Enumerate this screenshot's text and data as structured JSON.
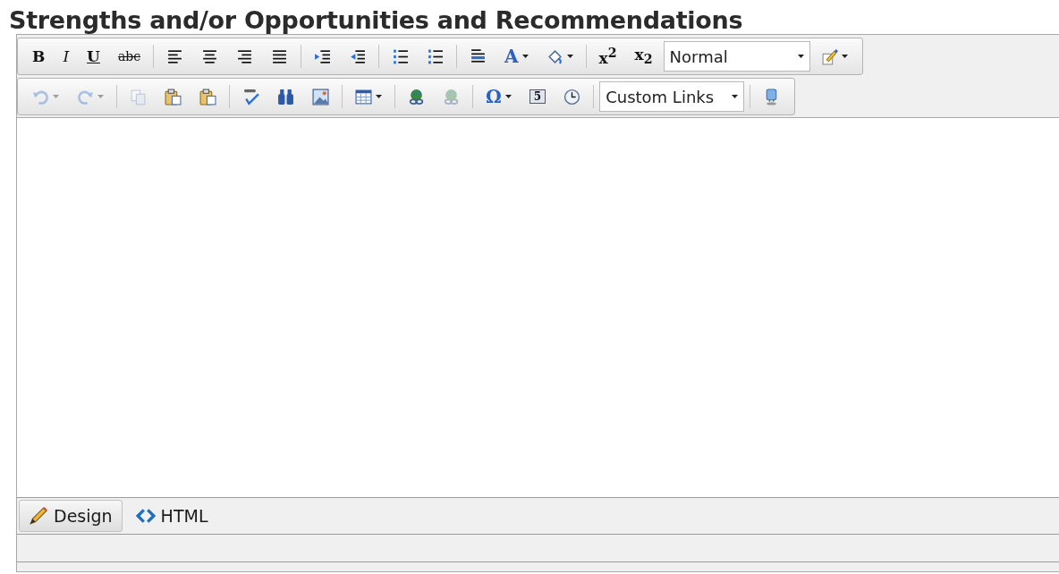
{
  "title": "Strengths and/or Opportunities and Recommendations",
  "toolbars": [
    {
      "items": [
        {
          "kind": "glyph",
          "text": "B",
          "disabled": false,
          "dropdown": false
        },
        {
          "kind": "glyph",
          "text": "I",
          "disabled": false,
          "dropdown": false
        },
        {
          "kind": "glyph",
          "text": "U",
          "disabled": false,
          "dropdown": false
        },
        {
          "kind": "glyph",
          "text": "abc",
          "disabled": false,
          "dropdown": false
        },
        {
          "kind": "separator"
        },
        {
          "kind": "icon",
          "disabled": false,
          "dropdown": false
        },
        {
          "kind": "icon",
          "disabled": false,
          "dropdown": false
        },
        {
          "kind": "icon",
          "disabled": false,
          "dropdown": false
        },
        {
          "kind": "icon",
          "disabled": false,
          "dropdown": false
        },
        {
          "kind": "separator"
        },
        {
          "kind": "icon",
          "disabled": false,
          "dropdown": false
        },
        {
          "kind": "icon",
          "disabled": false,
          "dropdown": false
        },
        {
          "kind": "separator"
        },
        {
          "kind": "icon",
          "disabled": false,
          "dropdown": false
        },
        {
          "kind": "icon",
          "disabled": false,
          "dropdown": false
        },
        {
          "kind": "separator"
        },
        {
          "kind": "icon",
          "disabled": false,
          "dropdown": false
        },
        {
          "kind": "glyph",
          "text": "A",
          "disabled": false,
          "dropdown": true
        },
        {
          "kind": "icon",
          "disabled": false,
          "dropdown": true
        },
        {
          "kind": "separator"
        },
        {
          "kind": "glyph",
          "text": "x$^{2}$",
          "disabled": false,
          "dropdown": false
        },
        {
          "kind": "glyph",
          "text": "x$_{2}$",
          "disabled": false,
          "dropdown": false
        },
        {
          "kind": "select",
          "value": "Normal"
        },
        {
          "kind": "icon",
          "disabled": false,
          "dropdown": true
        }
      ]
    },
    {
      "items": [
        {
          "kind": "icon",
          "disabled": true,
          "dropdown": true
        },
        {
          "kind": "icon",
          "disabled": true,
          "dropdown": true
        },
        {
          "kind": "separator"
        },
        {
          "kind": "icon",
          "disabled": true,
          "dropdown": false
        },
        {
          "kind": "icon",
          "disabled": false,
          "dropdown": false
        },
        {
          "kind": "icon",
          "disabled": false,
          "dropdown": false
        },
        {
          "kind": "separator"
        },
        {
          "kind": "icon",
          "disabled": false,
          "dropdown": false
        },
        {
          "kind": "icon",
          "disabled": false,
          "dropdown": false
        },
        {
          "kind": "icon",
          "disabled": false,
          "dropdown": false
        },
        {
          "kind": "separator"
        },
        {
          "kind": "icon",
          "disabled": false,
          "dropdown": true
        },
        {
          "kind": "separator"
        },
        {
          "kind": "icon",
          "disabled": false,
          "dropdown": false
        },
        {
          "kind": "icon",
          "disabled": true,
          "dropdown": false
        },
        {
          "kind": "separator"
        },
        {
          "kind": "glyph",
          "text": "Ω",
          "disabled": false,
          "dropdown": true
        },
        {
          "kind": "glyph",
          "text": "5",
          "disabled": false,
          "dropdown": false
        },
        {
          "kind": "icon",
          "disabled": false,
          "dropdown": false
        },
        {
          "kind": "separator"
        },
        {
          "kind": "select",
          "value": "Custom Links"
        },
        {
          "kind": "separator"
        },
        {
          "kind": "icon",
          "disabled": false,
          "dropdown": false
        }
      ]
    }
  ],
  "modes": [
    {
      "label": "Design",
      "selected": true
    },
    {
      "label": "HTML",
      "selected": false
    }
  ]
}
